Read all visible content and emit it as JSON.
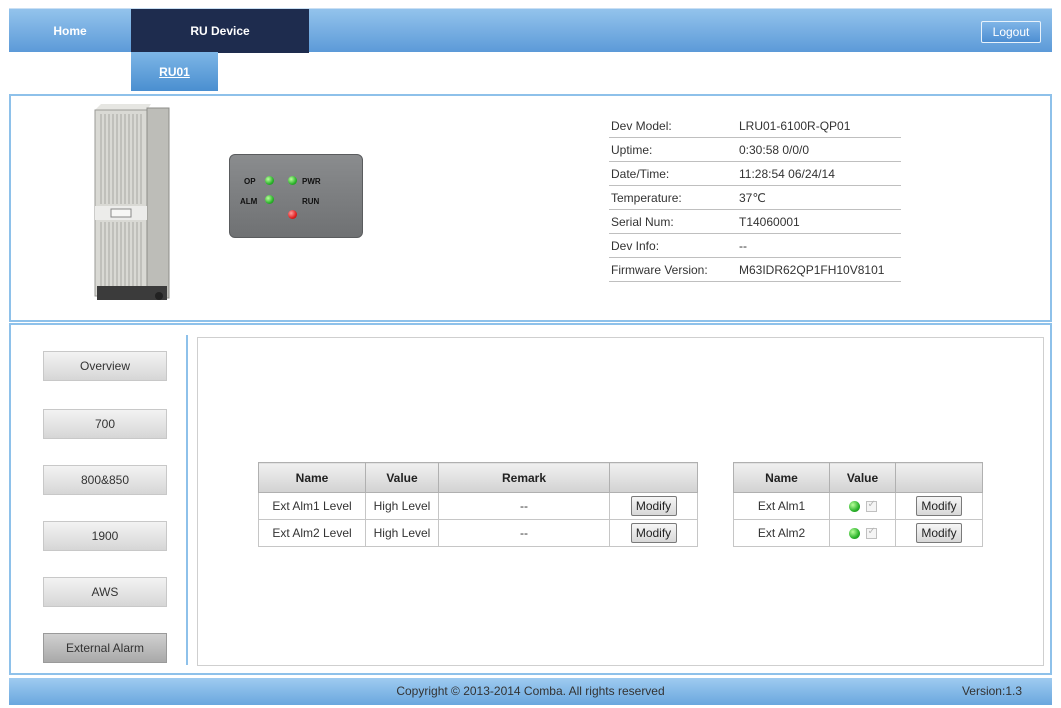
{
  "nav": {
    "home": "Home",
    "ru_device": "RU Device",
    "logout": "Logout"
  },
  "subtab": "RU01",
  "leds": {
    "op": "OP",
    "pwr": "PWR",
    "alm": "ALM",
    "run": "RUN"
  },
  "info": [
    {
      "key": "Dev Model:",
      "value": "LRU01-6100R-QP01"
    },
    {
      "key": "Uptime:",
      "value": "0:30:58 0/0/0"
    },
    {
      "key": "Date/Time:",
      "value": "11:28:54 06/24/14"
    },
    {
      "key": "Temperature:",
      "value": "37℃"
    },
    {
      "key": "Serial Num:",
      "value": "T14060001"
    },
    {
      "key": "Dev Info:",
      "value": "--"
    },
    {
      "key": "Firmware Version:",
      "value": "M63IDR62QP1FH10V8101"
    }
  ],
  "sidebar": [
    {
      "label": "Overview"
    },
    {
      "label": "700"
    },
    {
      "label": "800&850"
    },
    {
      "label": "1900"
    },
    {
      "label": "AWS"
    },
    {
      "label": "External Alarm"
    }
  ],
  "level_table": {
    "headers": [
      "Name",
      "Value",
      "Remark",
      ""
    ],
    "rows": [
      {
        "name": "Ext Alm1 Level",
        "value": "High Level",
        "remark": "--",
        "action": "Modify"
      },
      {
        "name": "Ext Alm2 Level",
        "value": "High Level",
        "remark": "--",
        "action": "Modify"
      }
    ]
  },
  "alarm_table": {
    "headers": [
      "Name",
      "Value",
      ""
    ],
    "rows": [
      {
        "name": "Ext Alm1",
        "action": "Modify"
      },
      {
        "name": "Ext Alm2",
        "action": "Modify"
      }
    ]
  },
  "footer": {
    "copyright": "Copyright © 2013-2014 Comba. All rights reserved",
    "version": "Version:1.3"
  },
  "colors": {
    "nav_active": "#1e2c4e",
    "accent": "#5c9ad8",
    "led_green": "#2bb32b",
    "led_red": "#e01f1f"
  }
}
